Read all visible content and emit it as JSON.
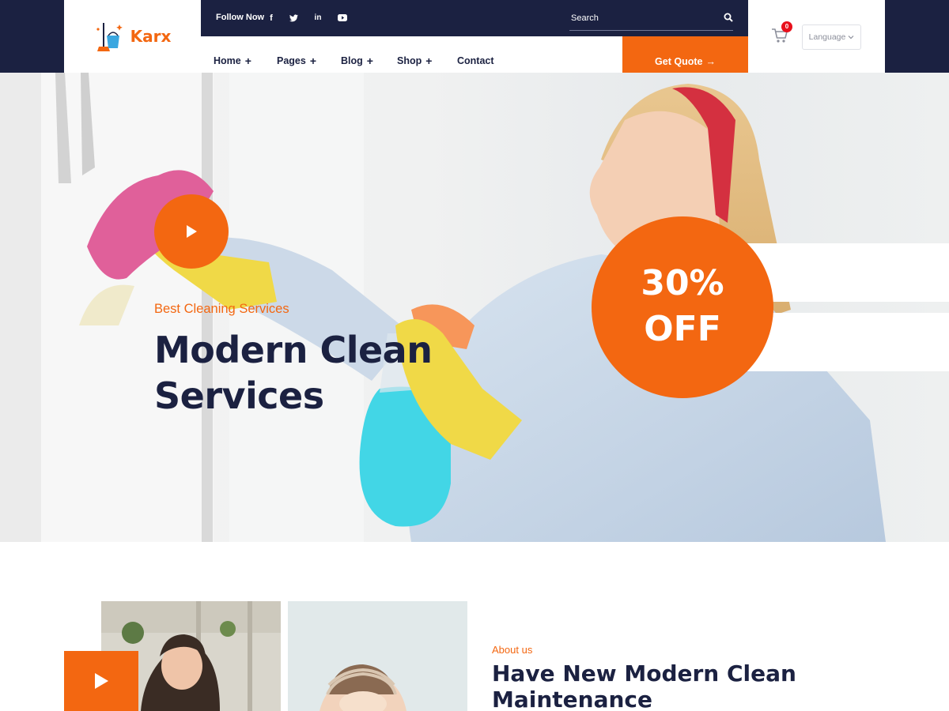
{
  "brand": {
    "name": "Karx"
  },
  "topbar": {
    "follow_label": "Follow Now",
    "social": [
      {
        "icon": "facebook-icon",
        "glyph": "f"
      },
      {
        "icon": "twitter-icon",
        "glyph": "t"
      },
      {
        "icon": "linkedin-icon",
        "glyph": "in"
      },
      {
        "icon": "youtube-icon",
        "glyph": "▶"
      }
    ],
    "search_placeholder": "Search"
  },
  "nav": {
    "items": [
      "Home",
      "Pages",
      "Blog",
      "Shop",
      "Contact"
    ],
    "quote_label": "Get Quote",
    "quote_arrow": "→"
  },
  "utility": {
    "cart_count": "0",
    "language_label": "Language"
  },
  "hero": {
    "subtitle": "Best Cleaning Services",
    "title": "Modern Clean Services",
    "discount_line1": "30%",
    "discount_line2": "OFF"
  },
  "about": {
    "subtitle": "About us",
    "title": "Have New Modern Clean Maintenance"
  },
  "colors": {
    "accent": "#f36711",
    "navy": "#1b2141",
    "badge": "#e8101c"
  }
}
